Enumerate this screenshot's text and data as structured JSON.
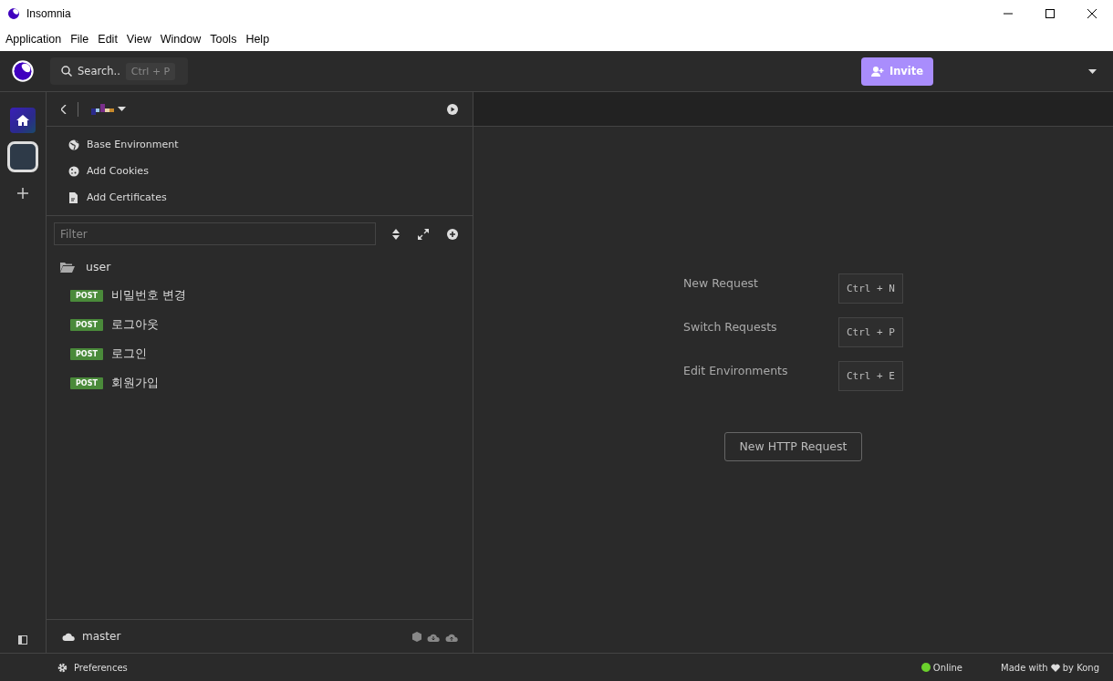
{
  "window": {
    "title": "Insomnia"
  },
  "menu": [
    "Application",
    "File",
    "Edit",
    "View",
    "Window",
    "Tools",
    "Help"
  ],
  "header": {
    "search": {
      "label": "Search..",
      "shortcut": "Ctrl + P"
    },
    "invite": "Invite"
  },
  "rail": [
    {
      "kind": "home",
      "selected": false
    },
    {
      "kind": "project",
      "selected": true
    },
    {
      "kind": "add",
      "selected": false
    }
  ],
  "sidebar": {
    "actions": [
      {
        "kind": "globe",
        "label": "Base Environment"
      },
      {
        "kind": "cookie",
        "label": "Add Cookies"
      },
      {
        "kind": "file",
        "label": "Add Certificates"
      }
    ],
    "filter": {
      "placeholder": "Filter"
    },
    "tree": [
      {
        "kind": "folder",
        "label": "user",
        "expanded": true,
        "children": [
          {
            "kind": "request",
            "method": "POST",
            "label": "비밀번호 변경"
          },
          {
            "kind": "request",
            "method": "POST",
            "label": "로그아웃"
          },
          {
            "kind": "request",
            "method": "POST",
            "label": "로그인"
          },
          {
            "kind": "request",
            "method": "POST",
            "label": "회원가입"
          }
        ]
      }
    ],
    "branch": "master"
  },
  "main": {
    "shortcuts": [
      {
        "label": "New Request",
        "keys": "Ctrl + N"
      },
      {
        "label": "Switch Requests",
        "keys": "Ctrl + P"
      },
      {
        "label": "Edit Environments",
        "keys": "Ctrl + E"
      }
    ],
    "button": "New HTTP Request"
  },
  "status_bar": {
    "preferences": "Preferences",
    "status": {
      "label": "Online",
      "color": "#6bd12c"
    },
    "made_with": "Made with",
    "by": "by Kong"
  }
}
